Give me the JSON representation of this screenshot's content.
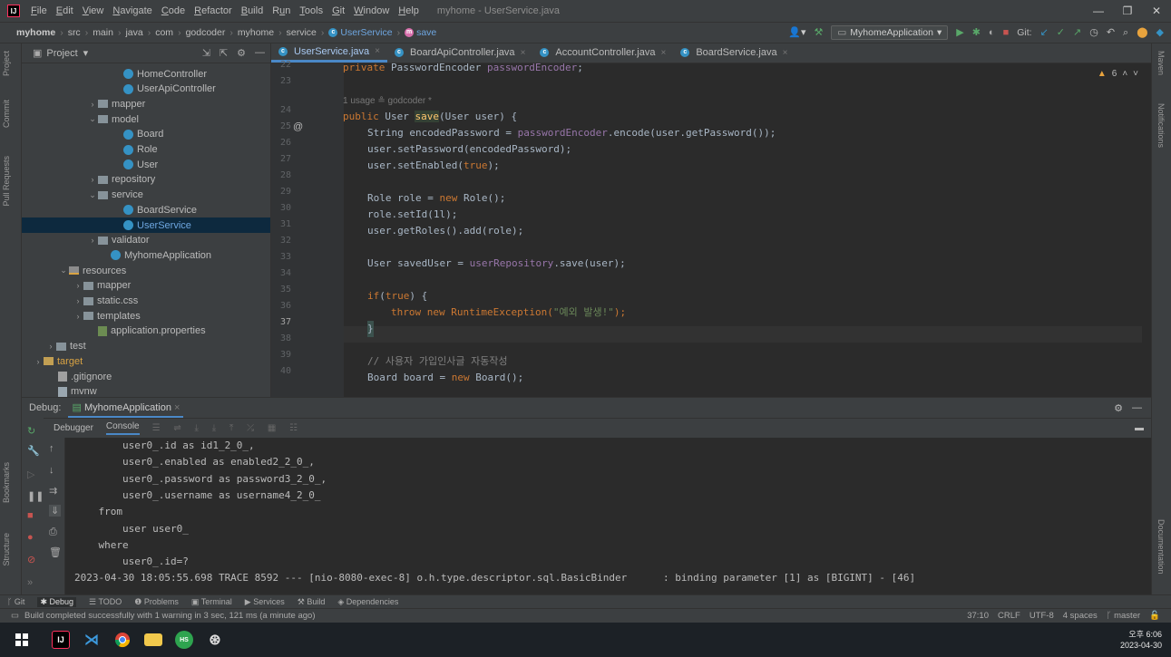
{
  "titlebar": {
    "menu": [
      "File",
      "Edit",
      "View",
      "Navigate",
      "Code",
      "Refactor",
      "Build",
      "Run",
      "Tools",
      "Git",
      "Window",
      "Help"
    ],
    "mnemonic": [
      "F",
      "E",
      "V",
      "N",
      "C",
      "R",
      "B",
      "u",
      "T",
      "G",
      "W",
      "H"
    ],
    "window_title": "myhome - UserService.java",
    "minimize": "—",
    "maximize": "❐",
    "close": "✕"
  },
  "breadcrumb": {
    "items": [
      "myhome",
      "src",
      "main",
      "java",
      "com",
      "godcoder",
      "myhome",
      "service",
      "UserService",
      "save"
    ]
  },
  "toolbar": {
    "run_config": "MyhomeApplication",
    "git_label": "Git:"
  },
  "left_tabs": [
    "Project",
    "Commit",
    "Pull Requests",
    "Bookmarks",
    "Structure"
  ],
  "right_tabs": [
    "Maven",
    "Notifications",
    "Documentation"
  ],
  "project": {
    "title": "Project",
    "tree": [
      {
        "label": "HomeController",
        "icon": "class"
      },
      {
        "label": "UserApiController",
        "icon": "class"
      },
      {
        "label": "mapper",
        "icon": "folder",
        "arrow": "›"
      },
      {
        "label": "model",
        "icon": "folder",
        "arrow": "⌄"
      },
      {
        "label": "Board",
        "icon": "class"
      },
      {
        "label": "Role",
        "icon": "class"
      },
      {
        "label": "User",
        "icon": "class"
      },
      {
        "label": "repository",
        "icon": "folder",
        "arrow": "›"
      },
      {
        "label": "service",
        "icon": "folder",
        "arrow": "⌄"
      },
      {
        "label": "BoardService",
        "icon": "class"
      },
      {
        "label": "UserService",
        "icon": "class",
        "selected": true
      },
      {
        "label": "validator",
        "icon": "folder",
        "arrow": "›"
      },
      {
        "label": "MyhomeApplication",
        "icon": "class"
      },
      {
        "label": "resources",
        "icon": "res",
        "arrow": "⌄"
      },
      {
        "label": "mapper",
        "icon": "folder",
        "arrow": "›"
      },
      {
        "label": "static.css",
        "icon": "folder",
        "arrow": "›"
      },
      {
        "label": "templates",
        "icon": "folder",
        "arrow": "›"
      },
      {
        "label": "application.properties",
        "icon": "prop"
      },
      {
        "label": "test",
        "icon": "folder",
        "arrow": "›"
      },
      {
        "label": "target",
        "icon": "target",
        "arrow": "›"
      },
      {
        "label": ".gitignore",
        "icon": "git"
      },
      {
        "label": "mvnw",
        "icon": "file"
      }
    ]
  },
  "editor": {
    "tabs": [
      {
        "label": "UserService.java",
        "active": true
      },
      {
        "label": "BoardApiController.java"
      },
      {
        "label": "AccountController.java"
      },
      {
        "label": "BoardService.java"
      }
    ],
    "warnings": "6",
    "usage_hint": "1 usage   ≗ godcoder *",
    "line_numbers": [
      "22",
      "23",
      "24",
      "25",
      "26",
      "27",
      "28",
      "29",
      "30",
      "31",
      "32",
      "33",
      "34",
      "35",
      "36",
      "37",
      "38",
      "39",
      "40"
    ],
    "code": {
      "l22": "private PasswordEncoder passwordEncoder;",
      "l24_a": "public ",
      "l24_b": "User ",
      "l24_c": "save",
      "l24_d": "(User user) {",
      "l25": "String encodedPassword = passwordEncoder.encode(user.getPassword());",
      "l26": "user.setPassword(encodedPassword);",
      "l27": "user.setEnabled(true);",
      "l29": "Role role = new Role();",
      "l30": "role.setId(1l);",
      "l31": "user.getRoles().add(role);",
      "l33": "User savedUser = userRepository.save(user);",
      "l35": "if(true) {",
      "l36": "throw new RuntimeException(\"예외 발생!\");",
      "l37": "}",
      "l39": "// 사용자 가입인사글 자동작성",
      "l40": "Board board = new Board();"
    }
  },
  "debug": {
    "label": "Debug:",
    "session": "MyhomeApplication",
    "subtabs": [
      "Debugger",
      "Console"
    ],
    "console": [
      "        user0_.id as id1_2_0_,",
      "        user0_.enabled as enabled2_2_0_,",
      "        user0_.password as password3_2_0_,",
      "        user0_.username as username4_2_0_",
      "    from",
      "        user user0_",
      "    where",
      "        user0_.id=?",
      "2023-04-30 18:05:55.698 TRACE 8592 --- [nio-8080-exec-8] o.h.type.descriptor.sql.BasicBinder      : binding parameter [1] as [BIGINT] - [46]"
    ]
  },
  "bottom_tools": [
    "Git",
    "Debug",
    "TODO",
    "Problems",
    "Terminal",
    "Services",
    "Build",
    "Dependencies"
  ],
  "status": {
    "message": "Build completed successfully with 1 warning in 3 sec, 121 ms (a minute ago)",
    "position": "37:10",
    "line_sep": "CRLF",
    "encoding": "UTF-8",
    "indent": "4 spaces",
    "branch": "master"
  },
  "taskbar": {
    "time": "오후 6:06",
    "date": "2023-04-30"
  },
  "colors": {
    "accent": "#4a88c7",
    "keyword": "#cc7832",
    "field": "#9876aa",
    "method": "#ffc66d",
    "string": "#6a8759"
  }
}
